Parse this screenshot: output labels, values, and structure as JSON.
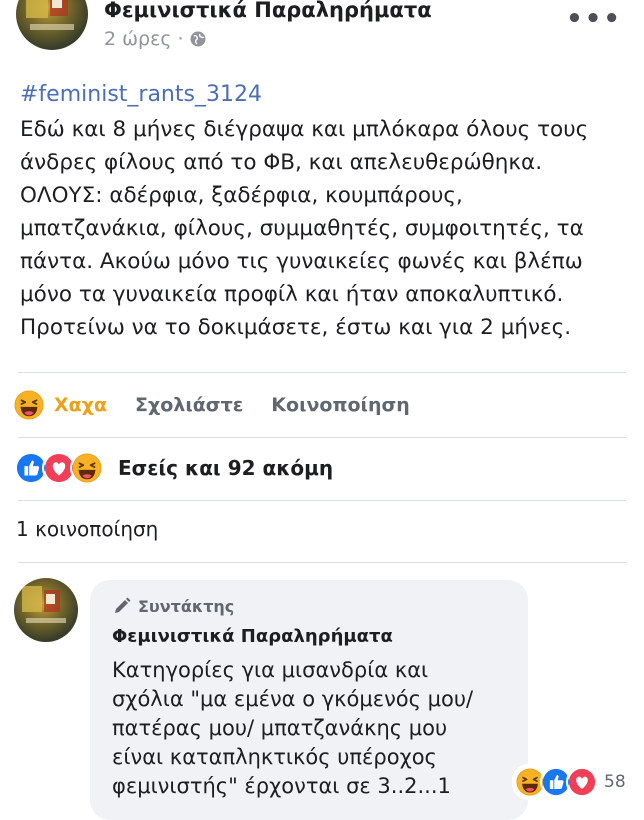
{
  "post": {
    "page_name": "Φεμινιστικά Παραληρήματα",
    "time": "2 ώρες",
    "dot": "·",
    "more": "•••",
    "hashtag": "#feminist_rants_3124",
    "text": "Εδώ και 8 μήνες διέγραψα και μπλόκαρα όλους τους\nάνδρες φίλους από το ΦΒ, και απελευθερώθηκα.\nΟΛΟΥΣ: αδέρφια, ξαδέρφια, κουμπάρους,\nμπατζανάκια, φίλους, συμμαθητές, συμφοιτητές, τα\nπάντα. Ακούω μόνο τις γυναικείες φωνές και βλέπω\nμόνο τα γυναικεία προφίλ και ήταν αποκαλυπτικό.\nΠροτείνω να το δοκιμάσετε, έστω και για 2 μήνες."
  },
  "actions": {
    "haha_label": "Χαχα",
    "comment_label": "Σχολιάστε",
    "share_label": "Κοινοποίηση"
  },
  "reactions": {
    "summary": "Εσείς και 92 ακόμη"
  },
  "shares": {
    "text": "1 κοινοποίηση"
  },
  "comment": {
    "badge": "Συντάκτης",
    "author": "Φεμινιστικά Παραληρήματα",
    "text": "Κατηγορίες για μισανδρία και\nσχόλια \"μα εμένα ο γκόμενός μου/\nπατέρας μου/ μπατζανάκης μου\nείναι καταπληκτικός υπέροχος\nφεμινιστής\" έρχονται σε 3..2...1",
    "reaction_count": "58"
  },
  "colors": {
    "link_blue": "#4b6eb4",
    "haha_yellow": "#e9a21c",
    "like_blue": "#1877f2",
    "love_red": "#f33e58",
    "muted": "#606770"
  },
  "icons": {
    "globe": "globe-icon",
    "haha": "haha-emoji-icon",
    "like": "like-icon",
    "love": "love-icon",
    "pencil": "pencil-icon"
  }
}
